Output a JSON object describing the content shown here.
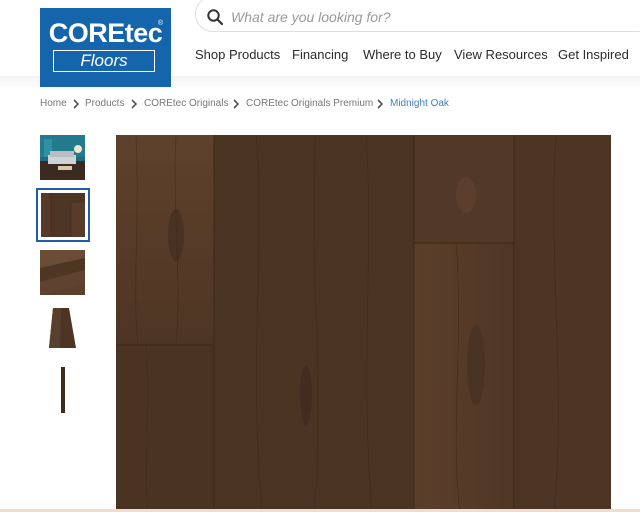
{
  "brand": {
    "name": "COREtec",
    "sub": "Floors",
    "reg": "®"
  },
  "search": {
    "placeholder": "What are you looking for?"
  },
  "nav": [
    "Shop Products",
    "Financing",
    "Where to Buy",
    "View Resources",
    "Get Inspired"
  ],
  "breadcrumb": [
    "Home",
    "Products",
    "COREtec Originals",
    "COREtec Originals Premium",
    "Midnight Oak"
  ],
  "gallery": {
    "thumbnails": [
      "room-scene",
      "plank-swatch",
      "plank-angle",
      "plank-perspective",
      "plank-edge"
    ],
    "selected_index": 1
  },
  "colors": {
    "brand_blue": "#1565ad",
    "link_blue": "#3d7fbf",
    "wood_dark": "#4a3322",
    "wood_mid": "#5a3f2a"
  }
}
